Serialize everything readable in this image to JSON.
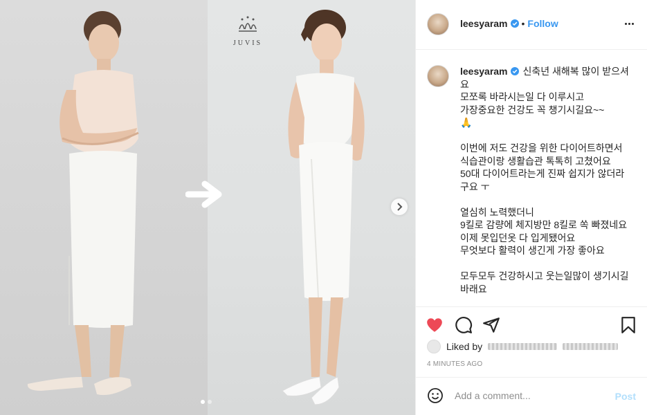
{
  "post": {
    "logo_text": "JUVIS",
    "carousel": {
      "slides": 2,
      "active": 0
    }
  },
  "header": {
    "username": "leesyaram",
    "separator": "•",
    "follow_label": "Follow"
  },
  "caption": {
    "username": "leesyaram",
    "text": "신축년 새해복 많이 받으셔요\n모쪼록 바라시는일 다 이루시고\n가장중요한 건강도 꼭 챙기시길요~~\n🙏\n\n이번에 저도 건강을 위한 다이어트하면서\n식습관이랑 생활습관 톡톡히 고쳤어요\n50대 다이어트라는게 진짜 쉽지가 않더라구요 ㅜ\n\n열심히 노력했더니\n9킬로 감량에 체지방만 8킬로 쏙 빠졌네요\n이제 못입던옷 다 입게됐어요\n무엇보다 활력이 생긴게 가장 좋아요\n\n모두모두 건강하시고 웃는일많이 생기시길바래요"
  },
  "likes": {
    "prefix": "Liked by"
  },
  "timestamp": "4 MINUTES AGO",
  "comment": {
    "placeholder": "Add a comment...",
    "post_label": "Post"
  },
  "colors": {
    "accent": "#3897f0",
    "heart": "#ed4956",
    "post_disabled": "#b2dffc",
    "muted": "#8e8e8e"
  },
  "icons": [
    "verified-icon",
    "more-icon",
    "heart-icon",
    "comment-icon",
    "share-icon",
    "bookmark-icon",
    "emoji-icon",
    "chevron-right-icon",
    "arrow-right-icon",
    "juvis-logo-icon"
  ]
}
